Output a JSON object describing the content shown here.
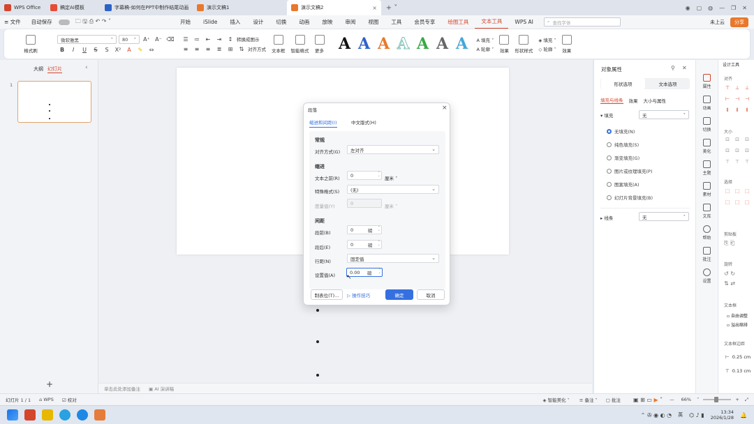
{
  "tabs": [
    {
      "label": "WPS Office",
      "color": "#d4452b"
    },
    {
      "label": "稿定AI模板",
      "color": "#e84a35"
    },
    {
      "label": "字幕稿-如何在PPT中制作结尾动画",
      "color": "#2b63c8"
    },
    {
      "label": "演示文稿1",
      "color": "#e8792c"
    },
    {
      "label": "演示文稿2",
      "color": "#e8792c"
    }
  ],
  "menubar": {
    "file": "文件",
    "autosave": "自动保存",
    "items": [
      "开始",
      "iSlide",
      "插入",
      "设计",
      "切换",
      "动画",
      "放映",
      "审阅",
      "视图",
      "工具",
      "会员专享",
      "绘图工具",
      "文本工具",
      "WPS AI"
    ],
    "search_placeholder": "查找字体",
    "login": "未上云",
    "share": "分享"
  },
  "ribbon": {
    "format_painter": "格式刷",
    "font_name": "微软雅黑",
    "font_size": "80",
    "text_box": "文本框",
    "arrange": "对齐方式",
    "shape_fill": "智能格式",
    "cross_ref": "转换成图示",
    "more": "更多",
    "fill": "填充",
    "outline": "轮廓",
    "effects": "效果",
    "shape_style": "形状样式",
    "wordart_a": [
      "A",
      "A",
      "A",
      "A",
      "A",
      "A",
      "A"
    ],
    "wordart_colors": [
      "#111111",
      "#2f62c9",
      "#e8792c",
      "#9dd2c8",
      "#3aa845",
      "#666666",
      "#45a7d8"
    ],
    "fill2": "填充",
    "outline2": "轮廓",
    "effects2": "效果"
  },
  "left_panel": {
    "tab_outline": "大纲",
    "tab_slides": "幻灯片",
    "slide_num": "1",
    "add": "+"
  },
  "notes_placeholder": "单击此处添加备注",
  "ai_notes": "AI 演讲稿",
  "dialog": {
    "title": "段落",
    "tab1": "缩进和间距(I)",
    "tab2": "中文版式(H)",
    "sec_general": "常规",
    "align_label": "对齐方式(G)",
    "align_value": "左对齐",
    "sec_indent": "缩进",
    "before_label": "文本之前(R)",
    "before_value": "0",
    "before_unit": "厘米",
    "special_label": "特殊格式(S)",
    "special_value": "(无)",
    "measure_label": "度量值(Y)",
    "measure_value": "0",
    "measure_unit": "厘米",
    "sec_spacing": "间距",
    "space_before_label": "段前(B)",
    "space_before_value": "0",
    "space_before_unit": "磅",
    "space_after_label": "段后(E)",
    "space_after_value": "0",
    "space_after_unit": "磅",
    "line_label": "行距(N)",
    "line_value": "固定值",
    "set_label": "设置值(A)",
    "set_value": "0.00",
    "set_unit": "磅",
    "tabs_btn": "制表位(T)...",
    "tips": "操作技巧",
    "ok": "确定",
    "cancel": "取消"
  },
  "props": {
    "title": "对象属性",
    "tab_shape": "形状选项",
    "tab_text": "文本选项",
    "sub_fill": "填充与线条",
    "sub_effect": "效果",
    "sub_size": "大小与属性",
    "fill_label": "填充",
    "fill_value": "无",
    "fill_options": [
      "无填充(N)",
      "纯色填充(S)",
      "渐变填充(G)",
      "图片或纹理填充(P)",
      "图案填充(A)",
      "幻灯片背景填充(B)"
    ],
    "line_label": "线条",
    "line_value": "无"
  },
  "rightside": [
    "属性",
    "动画",
    "切换",
    "美化",
    "主题",
    "素材",
    "文库",
    "帮助",
    "批注",
    "设置"
  ],
  "farright": {
    "title": "设计工具",
    "align": "对齐",
    "size": "大小",
    "select": "选择",
    "clipboard": "剪贴板",
    "rotate": "旋转",
    "textbox": "文本框",
    "autofit": "自由调整",
    "overflow": "溢出缩排",
    "margins": "文本框边距",
    "m1": "0.25 cm",
    "m2": "0.13 cm"
  },
  "status": {
    "slide_info": "幻灯片 1 / 1",
    "theme": "WPS",
    "proofing": "校对",
    "smart": "智能美化",
    "notes": "备注",
    "comments": "批注",
    "zoom": "66%"
  },
  "taskbar": {
    "lang": "英",
    "time": "13:34",
    "date": "2026/1/28"
  }
}
